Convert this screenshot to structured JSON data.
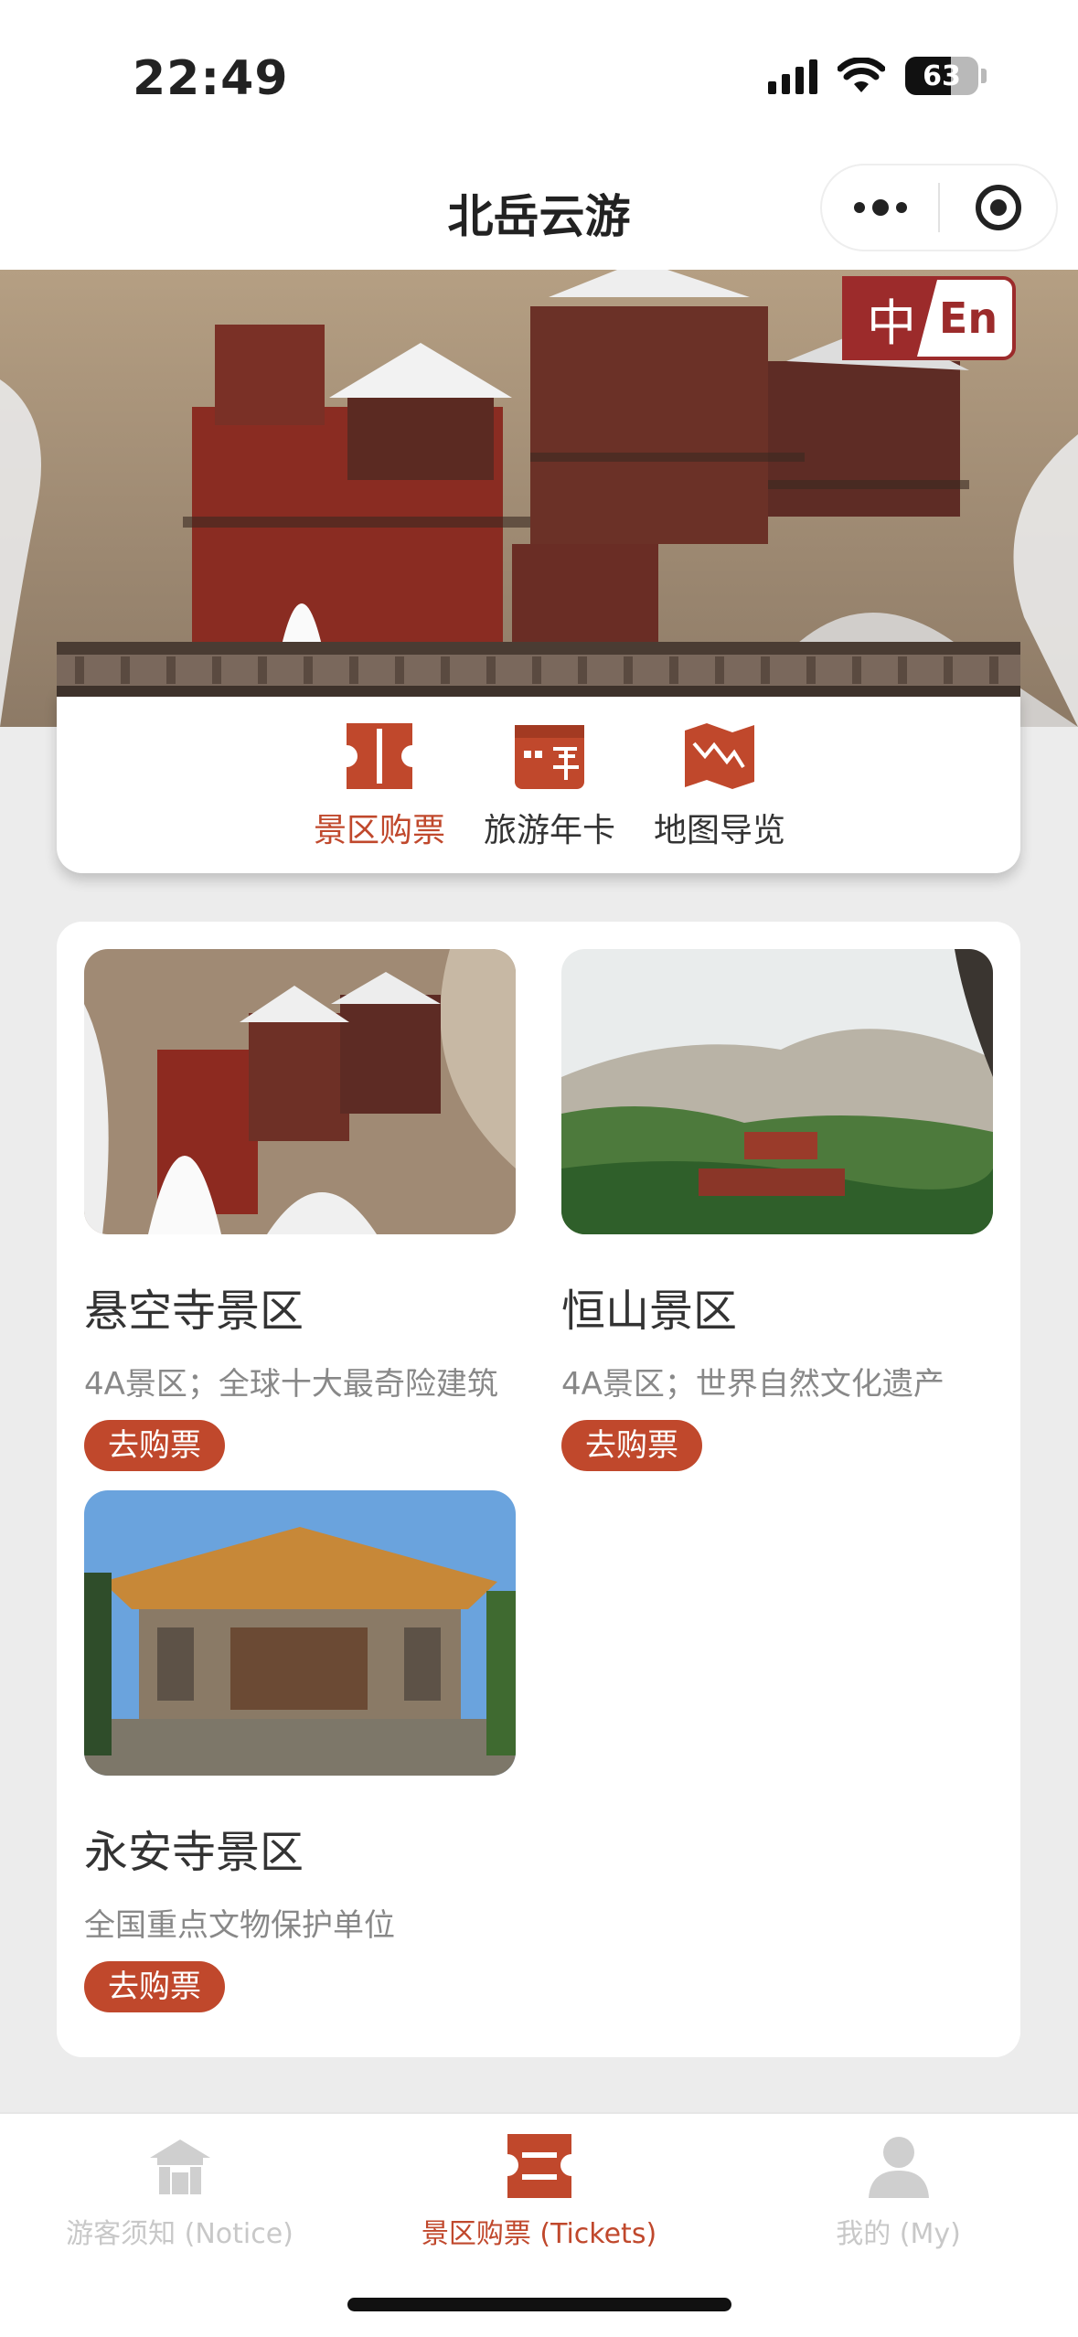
{
  "status_bar": {
    "time": "22:49",
    "battery": "63"
  },
  "nav": {
    "title": "北岳云游"
  },
  "language": {
    "zh": "中",
    "en": "En"
  },
  "quick_menu": [
    {
      "label": "景区购票",
      "icon": "ticket-icon",
      "active": true
    },
    {
      "label": "旅游年卡",
      "icon": "annual-card-icon",
      "active": false
    },
    {
      "label": "地图导览",
      "icon": "map-icon",
      "active": false
    }
  ],
  "spots": [
    {
      "name": "悬空寺景区",
      "desc": "4A景区；全球十大最奇险建筑",
      "button": "去购票"
    },
    {
      "name": "恒山景区",
      "desc": "4A景区；世界自然文化遗产",
      "button": "去购票"
    },
    {
      "name": "永安寺景区",
      "desc": "全国重点文物保护单位",
      "button": "去购票"
    }
  ],
  "tabs": [
    {
      "label": "游客须知 (Notice)",
      "icon": "notice-icon",
      "active": false
    },
    {
      "label": "景区购票 (Tickets)",
      "icon": "ticket-icon",
      "active": true
    },
    {
      "label": "我的 (My)",
      "icon": "user-icon",
      "active": false
    }
  ],
  "colors": {
    "accent": "#c0482c",
    "lang_red": "#9c2b2b"
  }
}
